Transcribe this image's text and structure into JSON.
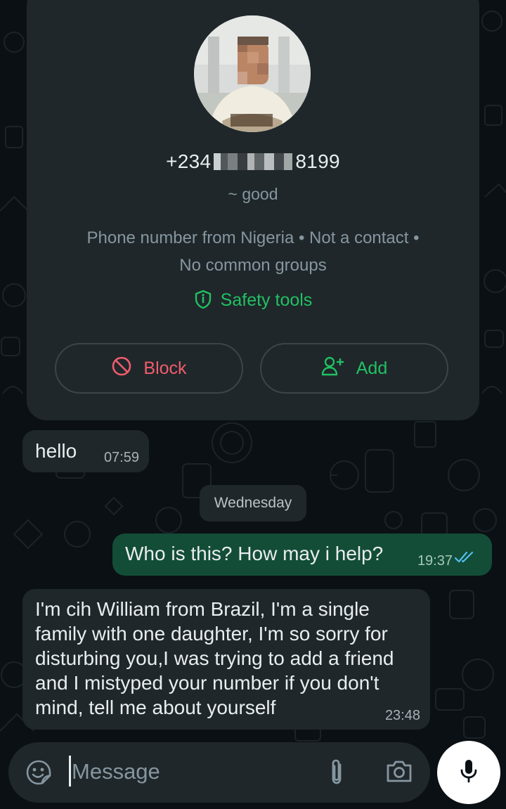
{
  "contact": {
    "phone_prefix": "+234",
    "phone_suffix": "8199",
    "about": "~ good",
    "info_line1": "Phone number from Nigeria • Not a contact •",
    "info_line2": "No common groups",
    "safety_label": "Safety tools",
    "block_label": "Block",
    "add_label": "Add"
  },
  "messages": [
    {
      "direction": "incoming",
      "text": "hello",
      "time": "07:59"
    },
    {
      "direction": "outgoing",
      "text": "Who is this? How may i help?",
      "time": "19:37",
      "status": "read"
    },
    {
      "direction": "incoming",
      "text": "I'm cih William from Brazil, I'm a single family with one daughter, I'm so sorry for disturbing you,I was trying to add a friend and I mistyped your number if you don't mind, tell me about yourself",
      "time": "23:48"
    }
  ],
  "day_separator": "Wednesday",
  "composer": {
    "placeholder": "Message"
  },
  "colors": {
    "background": "#0b1014",
    "bubble_incoming": "#1f272a",
    "bubble_outgoing": "#134d37",
    "accent_green": "#21c063",
    "block_red": "#f15c6d",
    "read_ticks": "#53bdeb"
  },
  "icons": [
    "shield-icon",
    "block-icon",
    "add-contact-icon",
    "read-ticks-icon",
    "sticker-icon",
    "attach-icon",
    "camera-icon",
    "mic-icon"
  ]
}
